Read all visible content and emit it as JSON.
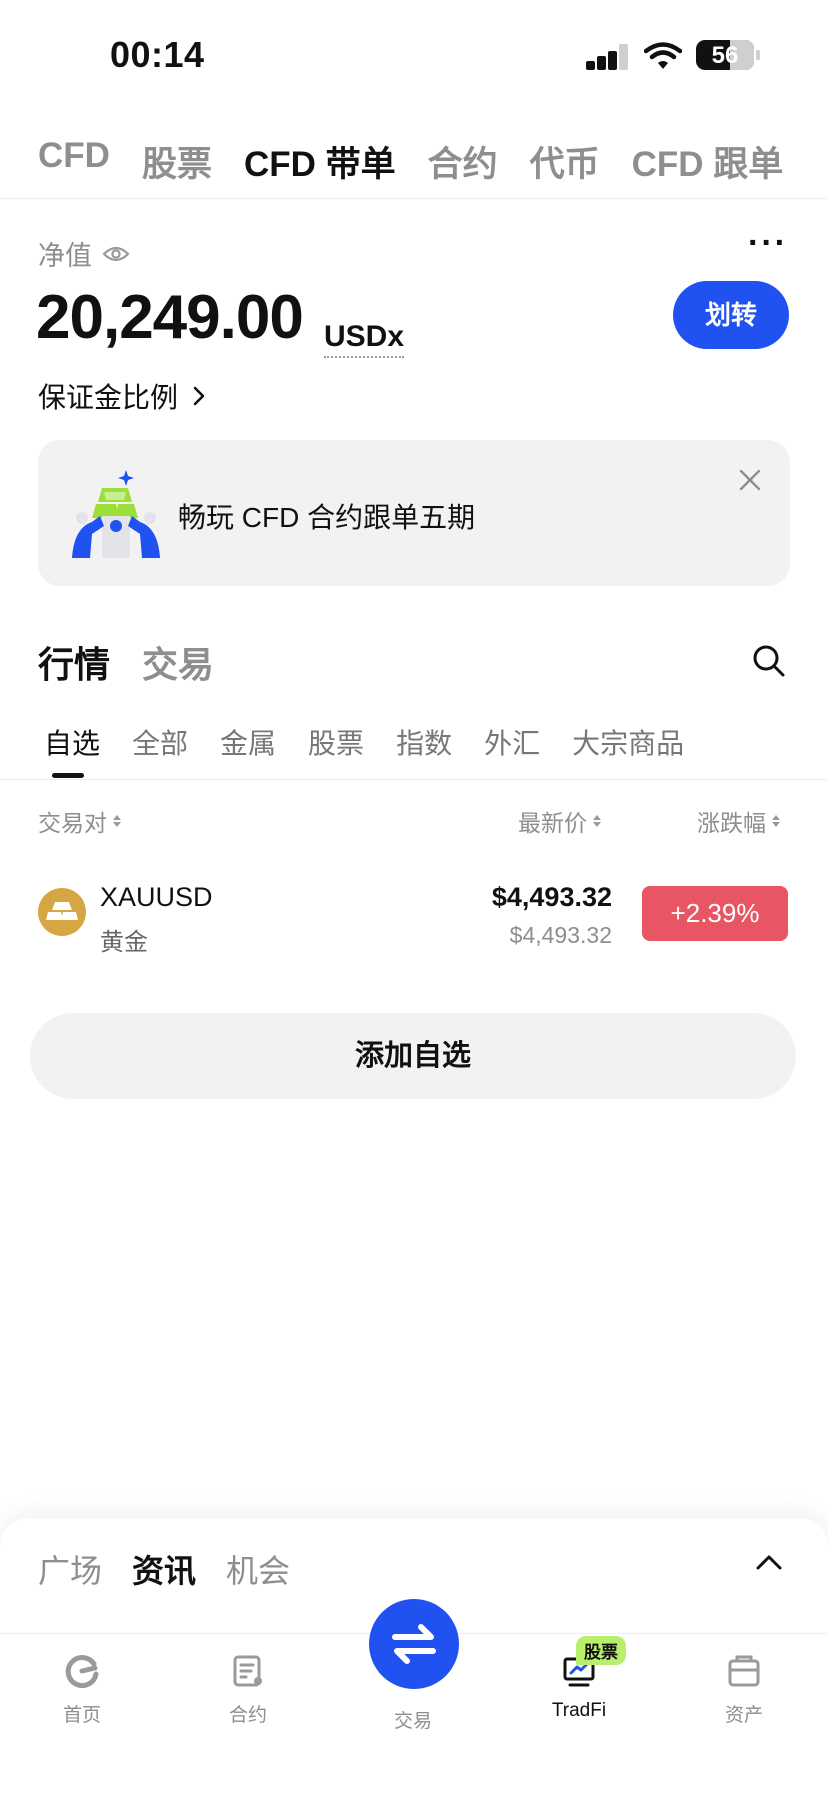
{
  "status_bar": {
    "time": "00:14",
    "battery": "56"
  },
  "top_tabs": [
    "CFD",
    "股票",
    "CFD 带单",
    "合约",
    "代币",
    "CFD 跟单"
  ],
  "top_tab_active": 2,
  "account": {
    "equity_label": "净值",
    "equity_value": "20,249.00",
    "equity_unit": "USDx",
    "transfer_label": "划转",
    "margin_ratio_label": "保证金比例",
    "more_label": "···"
  },
  "banner": {
    "text": "畅玩 CFD 合约跟单五期"
  },
  "market": {
    "section_tabs": [
      "行情",
      "交易"
    ],
    "categories": [
      "自选",
      "全部",
      "金属",
      "股票",
      "指数",
      "外汇",
      "大宗商品"
    ],
    "columns": {
      "pair": "交易对",
      "last_price": "最新价",
      "change": "涨跌幅"
    },
    "rows": [
      {
        "symbol": "XAUUSD",
        "name": "黄金",
        "price": "$4,493.32",
        "mark_price": "$4,493.32",
        "change": "+2.39%"
      }
    ],
    "add_watchlist_label": "添加自选"
  },
  "feed": {
    "tabs": [
      "广场",
      "资讯",
      "机会"
    ],
    "active": 1
  },
  "bottom_nav": {
    "home": "首页",
    "contracts": "合约",
    "trade": "交易",
    "tradfi": "TradFi",
    "tradfi_badge": "股票",
    "assets": "资产"
  },
  "colors": {
    "accent": "#1f52f0",
    "up": "#e85563",
    "gold": "#d5a642",
    "badge": "#b8f06b"
  }
}
